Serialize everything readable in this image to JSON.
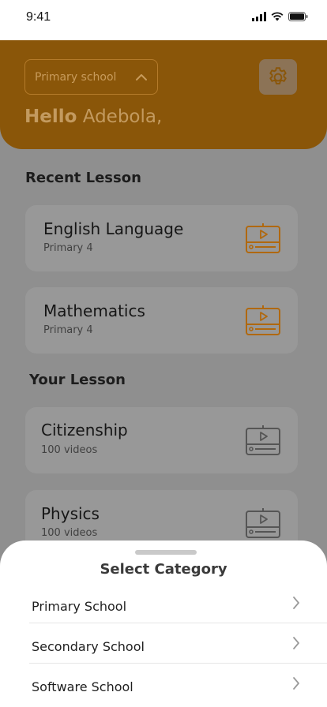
{
  "status_bar": {
    "time": "9:41"
  },
  "header": {
    "level_select": "Primary school",
    "greeting_bold": "Hello",
    "greeting_name": "Adebola,"
  },
  "sections": {
    "recent": "Recent Lesson",
    "yours": "Your Lesson"
  },
  "recent_lessons": [
    {
      "title": "English Language",
      "subtitle": "Primary 4"
    },
    {
      "title": "Mathematics",
      "subtitle": "Primary 4"
    }
  ],
  "your_lessons": [
    {
      "title": "Citizenship",
      "subtitle": "100 videos"
    },
    {
      "title": "Physics",
      "subtitle": "100 videos"
    }
  ],
  "sheet": {
    "title": "Select Category",
    "items": [
      {
        "label": "Primary School"
      },
      {
        "label": "Secondary School"
      },
      {
        "label": "Software School"
      }
    ]
  },
  "colors": {
    "accent_dimmed": "#8a5609",
    "accent_icon": "#b0680e",
    "overlay_background": "#8f8f8f"
  },
  "icons": {
    "settings": "gear-icon",
    "lesson": "video-player-icon",
    "chevron": "chevron-right-icon"
  }
}
